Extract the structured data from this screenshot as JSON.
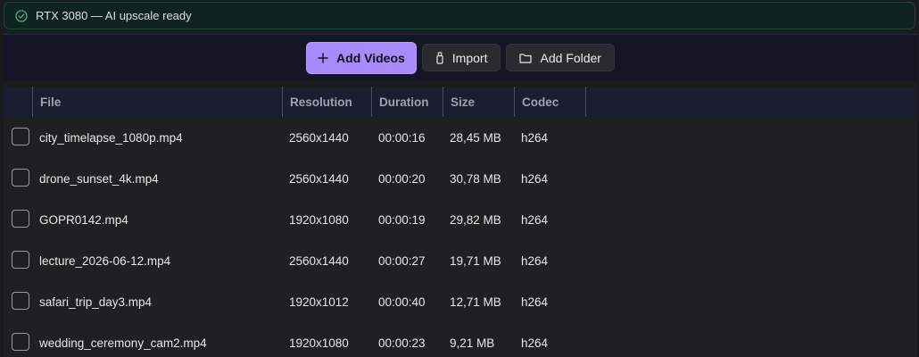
{
  "status": {
    "icon": "check-circle-icon",
    "text": "RTX 3080 — AI upscale ready",
    "color": "#2e8b6a"
  },
  "toolbar": {
    "add_videos": "Add Videos",
    "import": "Import",
    "add_folder": "Add Folder",
    "accent": "#a78bfa"
  },
  "table": {
    "columns": [
      "File",
      "Resolution",
      "Duration",
      "Size",
      "Codec"
    ],
    "rows": [
      {
        "file": "city_timelapse_1080p.mp4",
        "resolution": "2560x1440",
        "duration": "00:00:16",
        "size": "28,45 MB",
        "codec": "h264"
      },
      {
        "file": "drone_sunset_4k.mp4",
        "resolution": "2560x1440",
        "duration": "00:00:20",
        "size": "30,78 MB",
        "codec": "h264"
      },
      {
        "file": "GOPR0142.mp4",
        "resolution": "1920x1080",
        "duration": "00:00:19",
        "size": "29,82 MB",
        "codec": "h264"
      },
      {
        "file": "lecture_2026-06-12.mp4",
        "resolution": "2560x1440",
        "duration": "00:00:27",
        "size": "19,71 MB",
        "codec": "h264"
      },
      {
        "file": "safari_trip_day3.mp4",
        "resolution": "1920x1012",
        "duration": "00:00:40",
        "size": "12,71 MB",
        "codec": "h264"
      },
      {
        "file": "wedding_ceremony_cam2.mp4",
        "resolution": "1920x1080",
        "duration": "00:00:23",
        "size": "9,21 MB",
        "codec": "h264"
      }
    ]
  }
}
